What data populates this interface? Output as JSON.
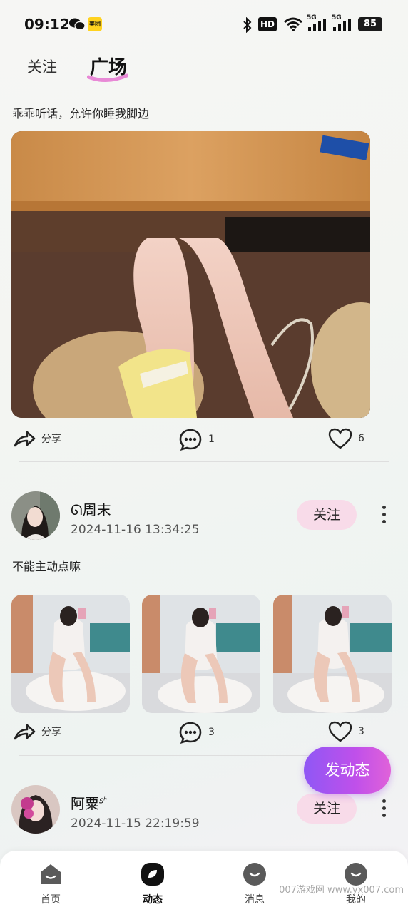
{
  "status_bar": {
    "time": "09:12",
    "wechat_badge": "美团",
    "hd_label": "HD",
    "net1": "5G",
    "net2": "5G",
    "battery": "85"
  },
  "tabs": [
    {
      "label": "关注"
    },
    {
      "label": "广场"
    }
  ],
  "posts": [
    {
      "caption": "乖乖听话，允许你睡我脚边",
      "share_label": "分享",
      "comment_count": "1",
      "like_count": "6"
    },
    {
      "username": "ᘏ周末",
      "time": "2024-11-16 13:34:25",
      "follow_label": "关注",
      "caption": "不能主动点嘛",
      "share_label": "分享",
      "comment_count": "3",
      "like_count": "3"
    },
    {
      "username": "阿粟",
      "username_suffix": "sʰ",
      "time": "2024-11-15 22:19:59",
      "follow_label": "关注"
    }
  ],
  "fab_label": "发动态",
  "bottom_nav": [
    {
      "label": "首页",
      "icon": "home-icon"
    },
    {
      "label": "动态",
      "icon": "moments-icon",
      "active": true
    },
    {
      "label": "消息",
      "icon": "message-icon"
    },
    {
      "label": "我的",
      "icon": "profile-icon"
    }
  ],
  "watermark": "007游戏网 www.yx007.com",
  "colors": {
    "accent_pink": "#f8dbe9",
    "fab_start": "#8f57f5",
    "fab_end": "#e062d9",
    "tab_underline": "#e889d6"
  }
}
